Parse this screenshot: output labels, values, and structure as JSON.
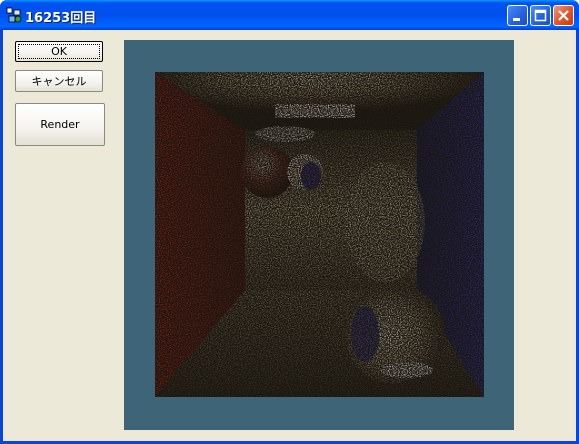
{
  "window": {
    "title": "16253回目",
    "icon": "app-icon",
    "controls": {
      "minimize": "minimize-icon",
      "maximize": "maximize-icon",
      "close": "close-icon"
    }
  },
  "buttons": {
    "ok_label": "OK",
    "cancel_label": "キャンセル",
    "render_label": "Render"
  },
  "render": {
    "scene": "cornell box path-traced render",
    "left_wall_color": "#c8321e",
    "right_wall_color": "#2c33b8",
    "panel_color": "#3e6478"
  }
}
